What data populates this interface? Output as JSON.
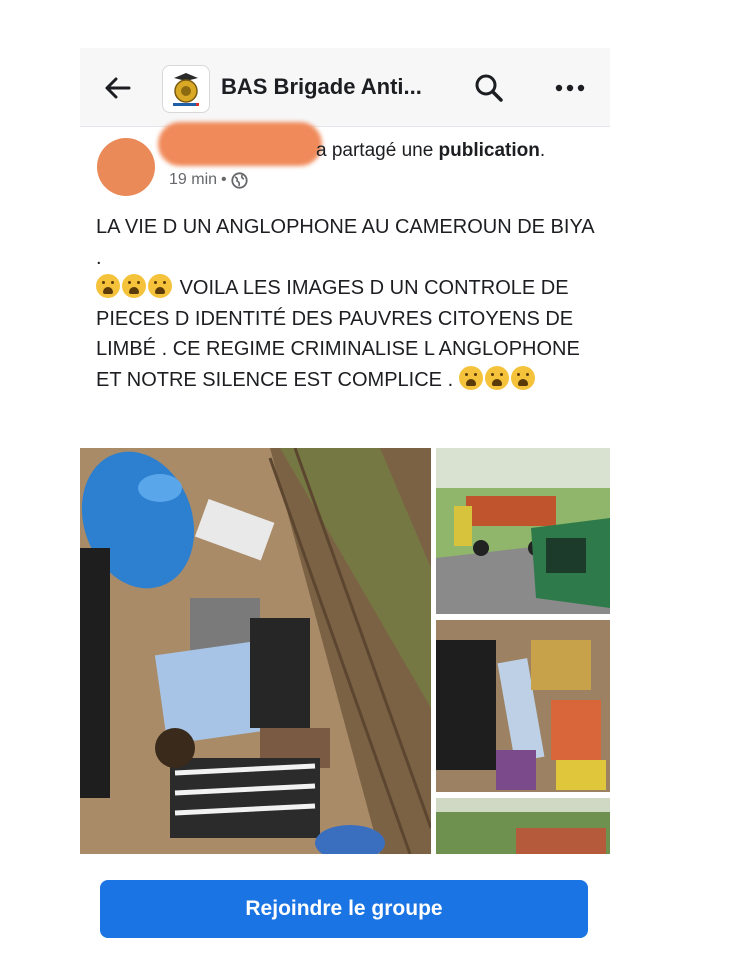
{
  "header": {
    "group_name": "BAS Brigade Anti...",
    "back_icon": "back-arrow-icon",
    "search_icon": "search-icon",
    "more_icon": "more-options-icon"
  },
  "post": {
    "shared_prefix": "a partagé une ",
    "shared_bold": "publication",
    "shared_suffix": ".",
    "time": "19 min",
    "separator": "•",
    "audience_icon": "globe-icon",
    "text_line1": "LA VIE D UN ANGLOPHONE AU CAMEROUN DE BIYA  .",
    "text_line2": "VOILA LES IMAGES D UN CONTROLE DE PIECES D IDENTITÉ  DES PAUVRES CITOYENS DE LIMBÉ . CE REGIME CRIMINALISE L ANGLOPHONE ET NOTRE SILENCE  EST COMPLICE  ."
  },
  "actions": {
    "join_label": "Rejoindre le groupe"
  },
  "colors": {
    "accent": "#1b74e4",
    "header_bg": "#f7f7f8",
    "redaction": "#f08a5a"
  }
}
